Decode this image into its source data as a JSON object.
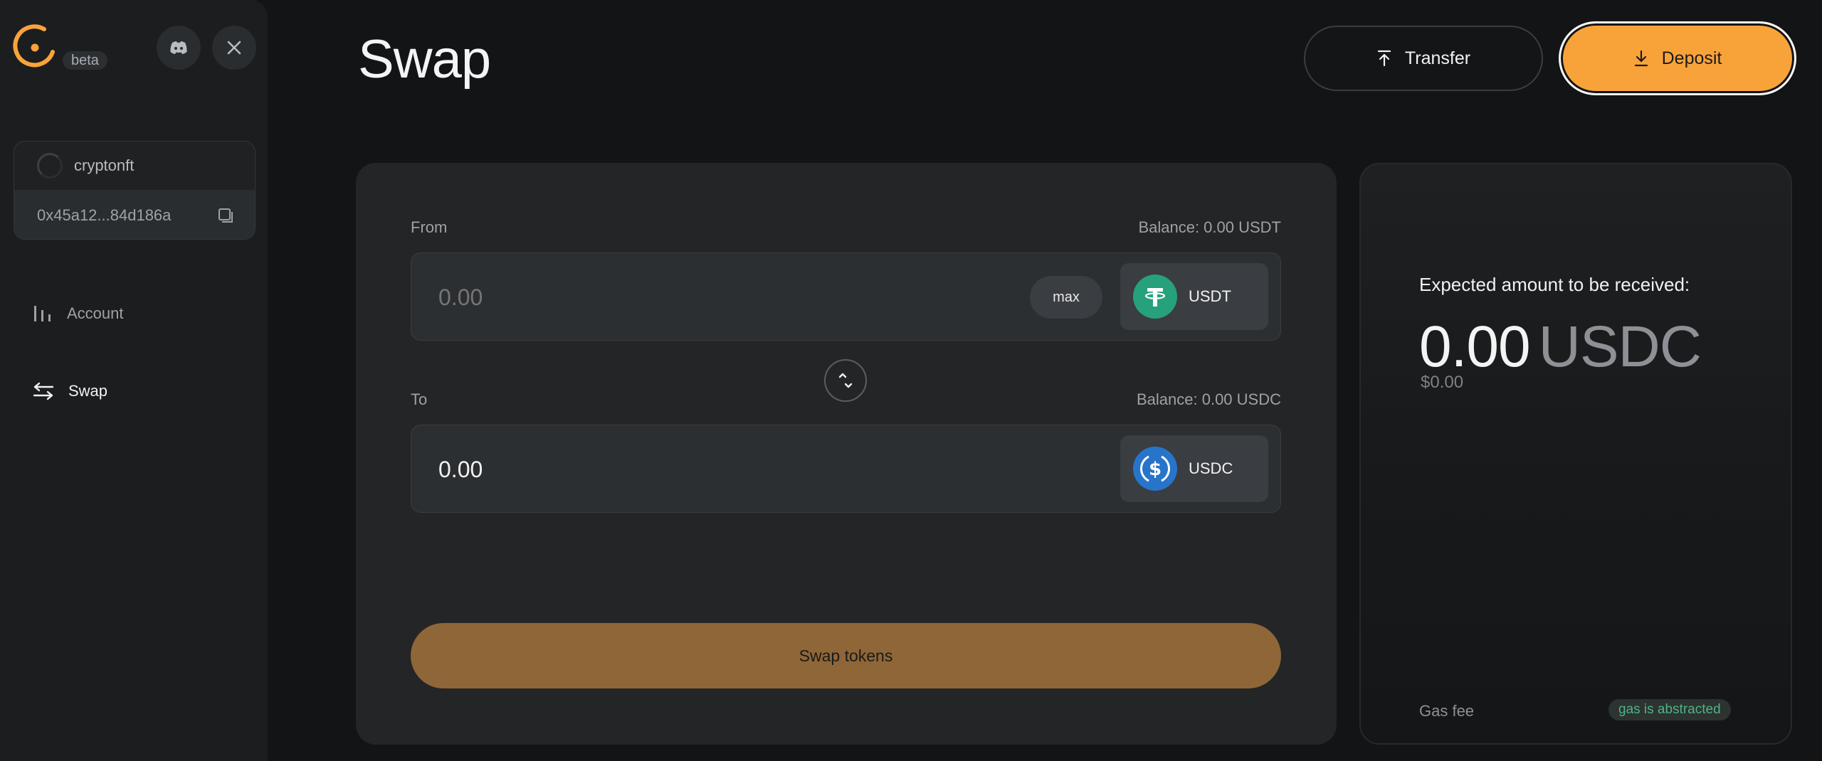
{
  "brand": {
    "badge": "beta",
    "accent": "#F8A33A"
  },
  "social": {
    "discord": "discord-icon",
    "x": "x-icon"
  },
  "wallet": {
    "name": "cryptonft",
    "address": "0x45a12...84d186a"
  },
  "sidebar": {
    "items": [
      {
        "label": "Account",
        "icon": "account-bars-icon"
      },
      {
        "label": "Swap",
        "icon": "swap-arrows-icon",
        "active": true
      }
    ]
  },
  "header": {
    "title": "Swap",
    "transfer_label": "Transfer",
    "deposit_label": "Deposit"
  },
  "swap": {
    "from": {
      "label": "From",
      "balance": "Balance: 0.00 USDT",
      "amount_placeholder": "0.00",
      "max_label": "max",
      "token": "USDT"
    },
    "to": {
      "label": "To",
      "balance": "Balance: 0.00 USDC",
      "amount": "0.00",
      "token": "USDC"
    },
    "submit_label": "Swap tokens"
  },
  "summary": {
    "heading": "Expected amount to be received:",
    "amount": "0.00",
    "unit": "USDC",
    "usd_value": "$0.00",
    "gas_label": "Gas fee",
    "gas_value": "gas is abstracted"
  }
}
